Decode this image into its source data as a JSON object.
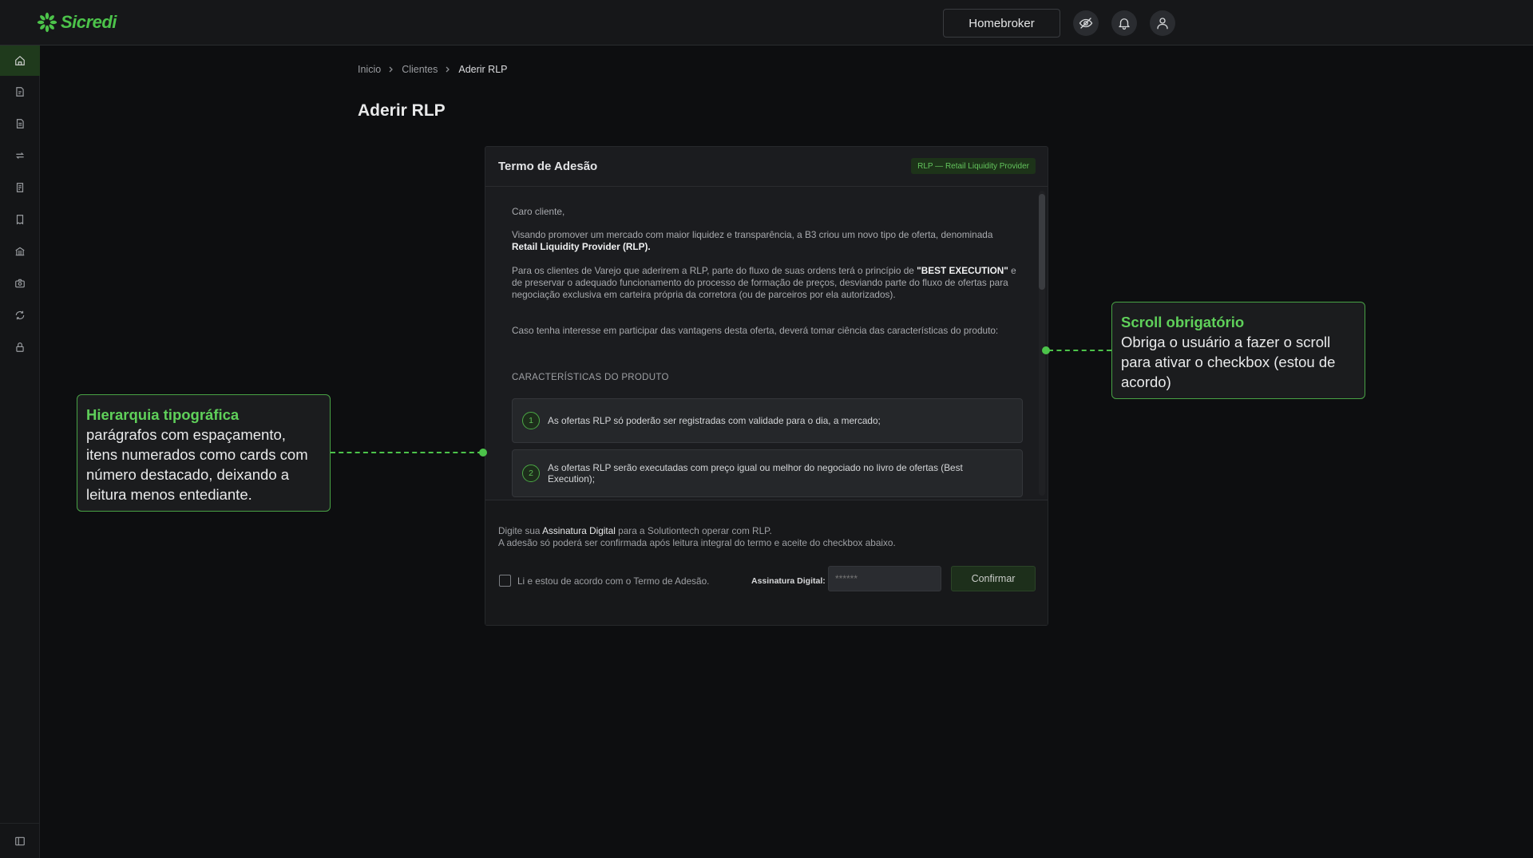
{
  "app": {
    "brand": "Sicredi",
    "brand_color": "#4cc34a"
  },
  "topbar": {
    "homebroker_label": "Homebroker",
    "icons": [
      "eye-off-icon",
      "bell-icon",
      "user-icon"
    ]
  },
  "sidebar": {
    "items": [
      {
        "icon": "home-icon",
        "active": true
      },
      {
        "icon": "document-edit-icon"
      },
      {
        "icon": "document-icon"
      },
      {
        "icon": "exchange-icon"
      },
      {
        "icon": "report-icon"
      },
      {
        "icon": "receipt-icon"
      },
      {
        "icon": "bank-icon"
      },
      {
        "icon": "camera-icon"
      },
      {
        "icon": "sync-icon"
      },
      {
        "icon": "lock-icon"
      }
    ],
    "bottom_icon": "sidebar-toggle-icon"
  },
  "breadcrumb": {
    "items": [
      "Inicio",
      "Clientes",
      "Aderir RLP"
    ]
  },
  "page": {
    "title": "Aderir RLP"
  },
  "term": {
    "title": "Termo de Adesão",
    "badge": "RLP — Retail Liquidity Provider",
    "greeting": "Caro cliente,",
    "p1_text": "Visando promover um mercado com maior liquidez e transparência, a B3 criou um novo tipo de oferta, denominada ",
    "p1_strong": "Retail Liquidity Provider (RLP).",
    "p2_text_a": "Para os clientes de Varejo que aderirem a RLP, parte do fluxo de suas ordens terá o princípio de ",
    "p2_strong": "\"BEST EXECUTION\"",
    "p2_text_b": " e de preservar o adequado funcionamento do processo de formação de preços, desviando parte do fluxo de ofertas para negociação exclusiva em carteira própria da corretora (ou de parceiros por ela autorizados).",
    "p3": "Caso tenha interesse em participar das vantagens desta oferta, deverá tomar ciência das características do produto:",
    "section_title": "CARACTERÍSTICAS DO PRODUTO",
    "items": [
      {
        "num": "1",
        "text": "As ofertas RLP só poderão ser registradas com validade para o dia, a mercado;"
      },
      {
        "num": "2",
        "text": "As ofertas RLP serão executadas com preço igual ou melhor do negociado no livro de ofertas (Best Execution);"
      }
    ]
  },
  "footer": {
    "line1_a": "Digite sua ",
    "line1_hl": "Assinatura Digital",
    "line1_b": " para a Solutiontech operar com RLP.",
    "line2": "A adesão só poderá ser confirmada após leitura integral do termo e aceite do checkbox abaixo.",
    "checkbox_label": "Li e estou de acordo com o Termo de Adesão.",
    "checkbox_checked": false,
    "signature_label": "Assinatura Digital:",
    "signature_placeholder": "******",
    "confirm_label": "Confirmar"
  },
  "annotations": {
    "left": {
      "title": "Hierarquia tipográfica",
      "body": "parágrafos com espaçamento, itens numerados como cards com número destacado, deixando a leitura menos entediante."
    },
    "right": {
      "title": "Scroll obrigatório",
      "body": "Obriga o usuário a fazer o scroll para ativar o checkbox (estou de acordo)"
    }
  }
}
